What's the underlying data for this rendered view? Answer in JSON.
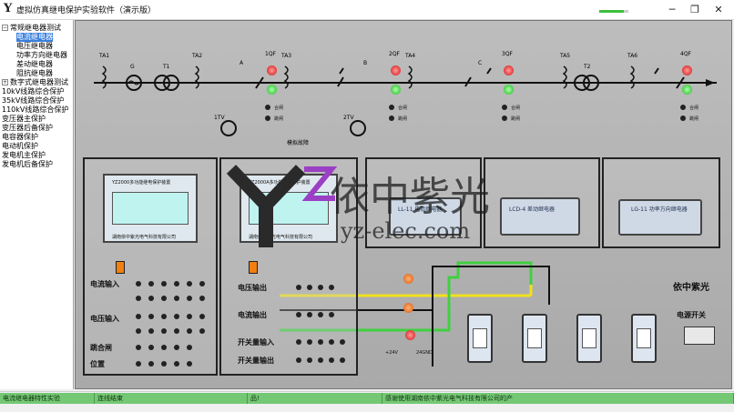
{
  "window": {
    "title": "虚拟仿真继电保护实验软件（演示版）",
    "logo": "Y",
    "minimize": "─",
    "maximize": "❐",
    "close": "✕",
    "progress": 0.85
  },
  "tree": [
    {
      "label": "常规继电器测试",
      "level": 0,
      "expanded": true
    },
    {
      "label": "电流继电器",
      "level": 1,
      "selected": true
    },
    {
      "label": "电压继电器",
      "level": 1
    },
    {
      "label": "功率方向继电器",
      "level": 1
    },
    {
      "label": "差动继电器",
      "level": 1
    },
    {
      "label": "阻抗继电器",
      "level": 1
    },
    {
      "label": "数字式继电器测试",
      "level": 0,
      "expanded": false
    },
    {
      "label": "10kV线路综合保护",
      "level": 0
    },
    {
      "label": "35kV线路综合保护",
      "level": 0
    },
    {
      "label": "110kV线路综合保护",
      "level": 0
    },
    {
      "label": "变压器主保护",
      "level": 0
    },
    {
      "label": "变压器后备保护",
      "level": 0
    },
    {
      "label": "电容器保护",
      "level": 0
    },
    {
      "label": "电动机保护",
      "level": 0
    },
    {
      "label": "发电机主保护",
      "level": 0
    },
    {
      "label": "发电机后备保护",
      "level": 0
    }
  ],
  "diagram": {
    "ta_labels": [
      "TA1",
      "TA2",
      "TA3",
      "TA4",
      "TA5",
      "TA6"
    ],
    "gen_label": "G",
    "t1_label": "T1",
    "t2_label": "T2",
    "bus_labels": [
      "A",
      "B",
      "C"
    ],
    "tv_labels": [
      "1TV",
      "2TV"
    ],
    "qf_labels": [
      "1QF",
      "2QF",
      "3QF",
      "4QF"
    ],
    "switch_labels": [
      "合闸",
      "跳闸"
    ],
    "fault_label": "模拟故障"
  },
  "panels": {
    "device1_title": "YZ2000多功能继电保护装置",
    "device1_vendor": "湖南依中紫光电气科技有限公司",
    "device2_title": "YZ2000A多功能继电保护装置",
    "device2_vendor": "湖南依中紫光电气科技有限公司",
    "labels_left": [
      "电流输入",
      "电压输入",
      "跳合闸",
      "位置"
    ],
    "labels_mid": [
      "电压输出",
      "电流输出",
      "开关量输入",
      "开关量输出"
    ],
    "plus_label": "+24V",
    "gnd_label": "24GND",
    "relay1": "LL-11  电流继电器",
    "relay2": "LCD-4  差动继电器",
    "relay3": "LG-11  功率方向继电器",
    "brand": "依中紫光",
    "power_switch": "电源开关"
  },
  "watermark": {
    "brand": "依中紫光",
    "url": "yz-elec.com"
  },
  "status": {
    "cell1": "电流继电器特性实验",
    "cell2": "连线结束",
    "cell3": "品!",
    "cell4": "感谢使用湖南依中紫光电气科技有限公司的产"
  },
  "colors": {
    "selected": "#3a7fdc",
    "status": "#74c874",
    "wire_yellow": "#f0e020",
    "wire_green": "#40d040",
    "wire_black": "#111111"
  }
}
